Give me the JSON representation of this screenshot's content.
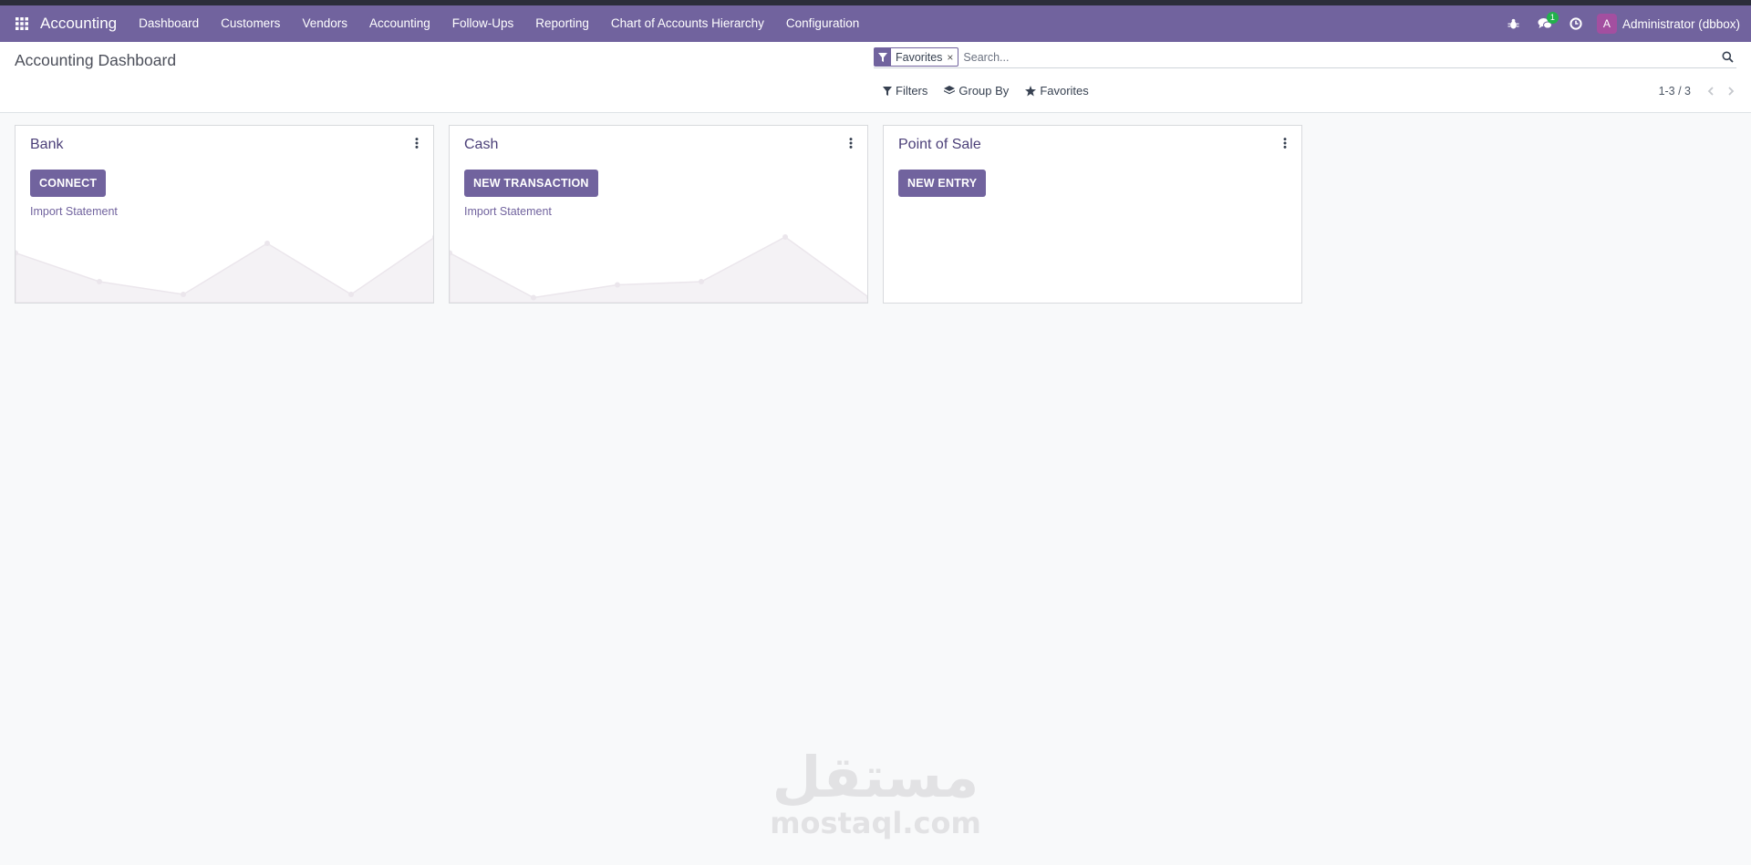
{
  "navbar": {
    "app_name": "Accounting",
    "menu": [
      "Dashboard",
      "Customers",
      "Vendors",
      "Accounting",
      "Follow-Ups",
      "Reporting",
      "Chart of Accounts Hierarchy",
      "Configuration"
    ],
    "messages_count": "1",
    "user": "Administrator (dbbox)",
    "user_initial": "A",
    "icons": [
      "apps-grid-icon",
      "bug-icon",
      "chat-icon",
      "clock-icon"
    ],
    "colors": {
      "brand": "#71639e",
      "avatar": "#a34fa0",
      "badge": "#22b14c"
    }
  },
  "control_panel": {
    "title": "Accounting Dashboard",
    "search": {
      "facet_value": "Favorites",
      "placeholder": "Search..."
    },
    "filter_buttons": [
      "Filters",
      "Group By",
      "Favorites"
    ],
    "pager": "1-3 / 3"
  },
  "cards": [
    {
      "title": "Bank",
      "button": "CONNECT",
      "link": "Import Statement",
      "graph": [
        0.75,
        0.3,
        0.1,
        0.9,
        0.1,
        1.0
      ]
    },
    {
      "title": "Cash",
      "button": "NEW TRANSACTION",
      "link": "Import Statement",
      "graph": [
        0.75,
        0.05,
        0.25,
        0.3,
        1.0,
        0.05
      ]
    },
    {
      "title": "Point of Sale",
      "button": "NEW ENTRY",
      "link": "",
      "graph": []
    }
  ],
  "watermark": {
    "arabic": "مستقل",
    "latin": "mostaql.com"
  }
}
